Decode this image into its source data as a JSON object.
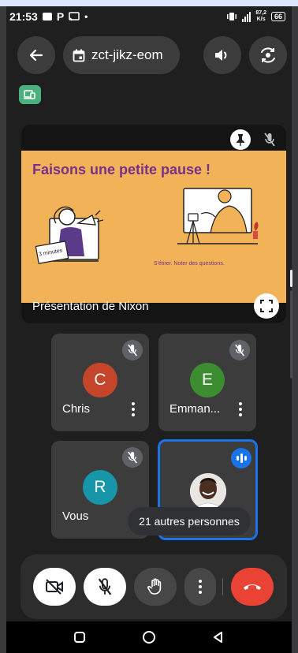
{
  "status_bar": {
    "time": "21:53",
    "letter": "P",
    "data_speed_value": "87,2",
    "data_speed_unit": "K/s",
    "battery": "66"
  },
  "topbar": {
    "meeting_code": "zct-jikz-eom"
  },
  "presentation": {
    "label": "Présentation de Nixon",
    "slide_title": "Faisons une petite pause !",
    "slide_subtitle": "S'étirer. Noter des questions.",
    "slide_tag": "3 minutes"
  },
  "participants": [
    {
      "name": "Chris",
      "initial": "C",
      "color": "#c5452a"
    },
    {
      "name": "Emman...",
      "initial": "E",
      "color": "#3c8d2f"
    },
    {
      "name": "Vous",
      "initial": "R",
      "color": "#1696a8"
    }
  ],
  "others_label": "21 autres personnes",
  "colors": {
    "accent": "#1a73e8",
    "end_call": "#ea4335"
  }
}
